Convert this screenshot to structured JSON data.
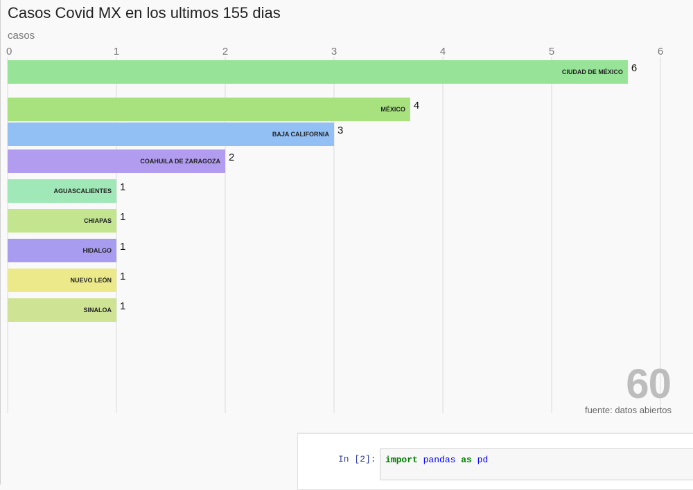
{
  "chart_data": {
    "type": "bar",
    "orientation": "horizontal",
    "title": "Casos Covid MX en los ultimos 155 dias",
    "xlabel": "casos",
    "xlim": [
      0,
      6
    ],
    "xticks": [
      "0",
      "1",
      "2",
      "3",
      "4",
      "5",
      "6"
    ],
    "grid": true,
    "counter": "60",
    "source": "fuente: datos abiertos",
    "bars": [
      {
        "category": "CIUDAD DE MÉXICO",
        "value": 5.7,
        "value_label": "6",
        "color": "#97e397"
      },
      {
        "category": "MÉXICO",
        "value": 3.7,
        "value_label": "4",
        "color": "#a8e27f"
      },
      {
        "category": "BAJA CALIFORNIA",
        "value": 3.0,
        "value_label": "3",
        "color": "#93c0f4"
      },
      {
        "category": "COAHUILA DE ZARAGOZA",
        "value": 2.0,
        "value_label": "2",
        "color": "#b29cef"
      },
      {
        "category": "AGUASCALIENTES",
        "value": 1.0,
        "value_label": "1",
        "color": "#a0e8b7"
      },
      {
        "category": "CHIAPAS",
        "value": 1.0,
        "value_label": "1",
        "color": "#c3e58f"
      },
      {
        "category": "HIDALGO",
        "value": 1.0,
        "value_label": "1",
        "color": "#a89cf0"
      },
      {
        "category": "NUEVO LEÓN",
        "value": 1.0,
        "value_label": "1",
        "color": "#ece98a"
      },
      {
        "category": "SINALOA",
        "value": 1.0,
        "value_label": "1",
        "color": "#cfe394"
      }
    ]
  },
  "notebook": {
    "prompt": "In [2]:",
    "code_keyword": "import",
    "code_module": "pandas",
    "code_as": "as",
    "code_alias": "pd"
  }
}
